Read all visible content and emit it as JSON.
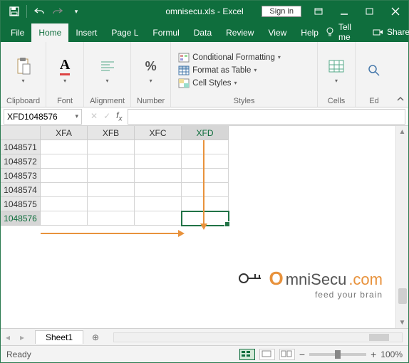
{
  "title": {
    "filename": "omnisecu.xls",
    "appname": "Excel",
    "full": "omnisecu.xls  -  Excel"
  },
  "signin": {
    "label": "Sign in"
  },
  "tabs": {
    "file": "File",
    "home": "Home",
    "insert": "Insert",
    "pagelayout": "Page L",
    "formulas": "Formul",
    "data": "Data",
    "review": "Review",
    "view": "View",
    "help": "Help",
    "tellme": "Tell me",
    "share": "Share"
  },
  "ribbon": {
    "clipboard": "Clipboard",
    "font": "Font",
    "alignment": "Alignment",
    "number": "Number",
    "styles": "Styles",
    "cells": "Cells",
    "editing": "Ed",
    "cond_fmt": "Conditional Formatting",
    "fmt_table": "Format as Table",
    "cell_styles": "Cell Styles",
    "font_letter": "A",
    "percent": "%"
  },
  "namebox": {
    "value": "XFD1048576"
  },
  "columns": [
    "XFA",
    "XFB",
    "XFC",
    "XFD"
  ],
  "rows": [
    "1048571",
    "1048572",
    "1048573",
    "1048574",
    "1048575",
    "1048576"
  ],
  "sheet": {
    "name": "Sheet1"
  },
  "status": {
    "ready": "Ready",
    "zoom": "100%",
    "minus": "−",
    "plus": "+"
  },
  "watermark": {
    "text1": "mniSecu",
    "text2": ".com",
    "tag": "feed your brain"
  }
}
